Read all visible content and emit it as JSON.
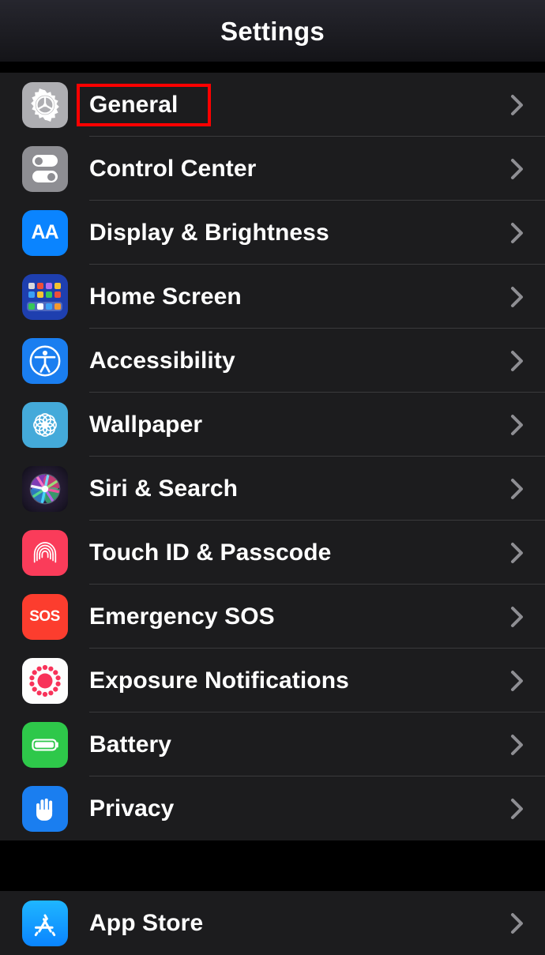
{
  "header": {
    "title": "Settings"
  },
  "colors": {
    "list_background": "#1c1c1e",
    "screen_background": "#000000",
    "separator": "#3a3a3c",
    "label_text": "#ffffff",
    "chevron": "#8e8e93",
    "highlight_border": "#ff0000"
  },
  "highlight": {
    "target_label": "General",
    "shape": "rectangle-outline"
  },
  "groups": [
    {
      "name": "main-settings-group",
      "rows": [
        {
          "label": "General",
          "icon": "gear-icon",
          "chevron": "chevron-right-icon",
          "highlighted": true
        },
        {
          "label": "Control Center",
          "icon": "toggles-icon",
          "chevron": "chevron-right-icon",
          "highlighted": false
        },
        {
          "label": "Display & Brightness",
          "icon": "text-size-aa-icon",
          "chevron": "chevron-right-icon",
          "highlighted": false
        },
        {
          "label": "Home Screen",
          "icon": "app-grid-icon",
          "chevron": "chevron-right-icon",
          "highlighted": false
        },
        {
          "label": "Accessibility",
          "icon": "accessibility-person-icon",
          "chevron": "chevron-right-icon",
          "highlighted": false
        },
        {
          "label": "Wallpaper",
          "icon": "flower-pattern-icon",
          "chevron": "chevron-right-icon",
          "highlighted": false
        },
        {
          "label": "Siri & Search",
          "icon": "siri-orb-icon",
          "chevron": "chevron-right-icon",
          "highlighted": false
        },
        {
          "label": "Touch ID & Passcode",
          "icon": "fingerprint-icon",
          "chevron": "chevron-right-icon",
          "highlighted": false
        },
        {
          "label": "Emergency SOS",
          "icon": "sos-icon",
          "chevron": "chevron-right-icon",
          "highlighted": false
        },
        {
          "label": "Exposure Notifications",
          "icon": "exposure-dots-icon",
          "chevron": "chevron-right-icon",
          "highlighted": false
        },
        {
          "label": "Battery",
          "icon": "battery-icon",
          "chevron": "chevron-right-icon",
          "highlighted": false
        },
        {
          "label": "Privacy",
          "icon": "hand-icon",
          "chevron": "chevron-right-icon",
          "highlighted": false
        }
      ]
    },
    {
      "name": "store-settings-group",
      "rows": [
        {
          "label": "App Store",
          "icon": "app-store-icon",
          "chevron": "chevron-right-icon",
          "highlighted": false
        }
      ]
    }
  ]
}
